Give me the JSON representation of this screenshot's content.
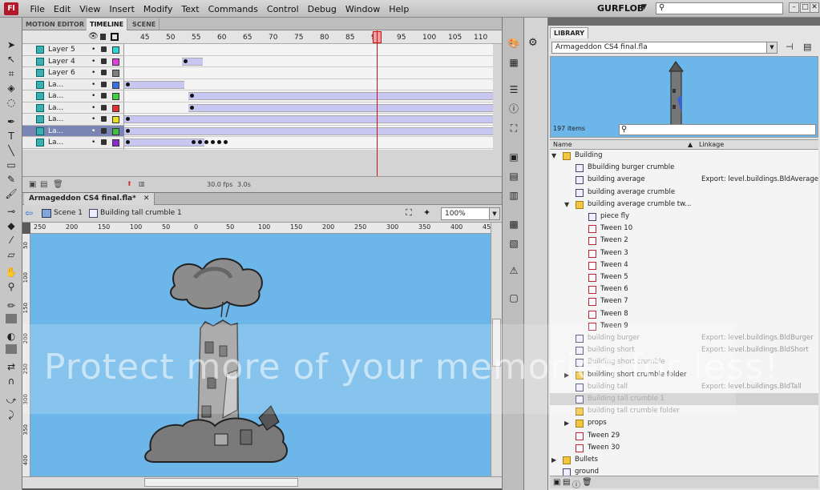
{
  "app": {
    "logo": "Fl",
    "workspace": "GURFLOB"
  },
  "menu": [
    "File",
    "Edit",
    "View",
    "Insert",
    "Modify",
    "Text",
    "Commands",
    "Control",
    "Debug",
    "Window",
    "Help"
  ],
  "timeline": {
    "tabs": [
      "MOTION EDITOR",
      "TIMELINE",
      "SCENE"
    ],
    "ticks": [
      "45",
      "50",
      "55",
      "60",
      "65",
      "70",
      "75",
      "80",
      "85",
      "90",
      "95",
      "100",
      "105",
      "110"
    ],
    "layers": [
      {
        "name": "Layer 5",
        "color": "#2fd8d8"
      },
      {
        "name": "Layer 4",
        "color": "#e040e0"
      },
      {
        "name": "Layer 6",
        "color": "#808080"
      },
      {
        "name": "La...",
        "color": "#3a6fe8"
      },
      {
        "name": "La...",
        "color": "#40d040"
      },
      {
        "name": "La...",
        "color": "#e03030"
      },
      {
        "name": "La...",
        "color": "#e8e020"
      },
      {
        "name": "La...",
        "color": "#40c040"
      },
      {
        "name": "La...",
        "color": "#8a2ad0"
      }
    ],
    "selected_layer": 7,
    "footer": {
      "fps": "30.0 fps",
      "time": "3.0s"
    }
  },
  "document": {
    "tab": "Armageddon CS4 final.fla*",
    "breadcrumb": [
      "Scene 1",
      "Building tall crumble 1"
    ],
    "zoom": "100%",
    "ruler_h": [
      "250",
      "200",
      "150",
      "100",
      "50",
      "0",
      "50",
      "100",
      "150",
      "200",
      "250",
      "300",
      "350",
      "400",
      "450"
    ],
    "ruler_v": [
      "50",
      "100",
      "150",
      "200",
      "250",
      "300",
      "350",
      "400"
    ]
  },
  "library": {
    "tab": "LIBRARY",
    "file": "Armageddon CS4 final.fla",
    "count": "197 items",
    "col_name": "Name",
    "col_link": "Linkage",
    "items": [
      {
        "name": "Building",
        "type": "folder",
        "indent": 1,
        "arrow": "▼",
        "link": ""
      },
      {
        "name": "Bbuilding burger crumble",
        "type": "sym",
        "indent": 2,
        "link": ""
      },
      {
        "name": "building average",
        "type": "sym",
        "indent": 2,
        "link": "Export: level.buildings.BldAverage"
      },
      {
        "name": "building average crumble",
        "type": "sym",
        "indent": 2,
        "link": ""
      },
      {
        "name": "building average crumble tw...",
        "type": "folder",
        "indent": 2,
        "arrow": "▼",
        "link": ""
      },
      {
        "name": "piece fly",
        "type": "sym",
        "indent": 3,
        "link": ""
      },
      {
        "name": "Tween 10",
        "type": "tween",
        "indent": 3,
        "link": ""
      },
      {
        "name": "Tween 2",
        "type": "tween",
        "indent": 3,
        "link": ""
      },
      {
        "name": "Tween 3",
        "type": "tween",
        "indent": 3,
        "link": ""
      },
      {
        "name": "Tween 4",
        "type": "tween",
        "indent": 3,
        "link": ""
      },
      {
        "name": "Tween 5",
        "type": "tween",
        "indent": 3,
        "link": ""
      },
      {
        "name": "Tween 6",
        "type": "tween",
        "indent": 3,
        "link": ""
      },
      {
        "name": "Tween 7",
        "type": "tween",
        "indent": 3,
        "link": ""
      },
      {
        "name": "Tween 8",
        "type": "tween",
        "indent": 3,
        "link": ""
      },
      {
        "name": "Tween 9",
        "type": "tween",
        "indent": 3,
        "link": ""
      },
      {
        "name": "building burger",
        "type": "sym",
        "indent": 2,
        "link": "Export: level.buildings.BldBurger",
        "dim": true
      },
      {
        "name": "building short",
        "type": "sym",
        "indent": 2,
        "link": "Export: level.buildings.BldShort",
        "dim": true
      },
      {
        "name": "Building short crumble",
        "type": "sym",
        "indent": 2,
        "link": "",
        "dim": true
      },
      {
        "name": "building short crumble folder",
        "type": "folder",
        "indent": 2,
        "arrow": "▶",
        "link": ""
      },
      {
        "name": "building tall",
        "type": "sym",
        "indent": 2,
        "link": "Export: level.buildings.BldTall",
        "dim": true
      },
      {
        "name": "Building tall crumble 1",
        "type": "sym",
        "indent": 2,
        "link": "",
        "dim": true,
        "hl": true
      },
      {
        "name": "building tall crumble folder",
        "type": "folder",
        "indent": 2,
        "link": "",
        "dim": true
      },
      {
        "name": "props",
        "type": "folder",
        "indent": 2,
        "arrow": "▶",
        "link": ""
      },
      {
        "name": "Tween 29",
        "type": "tween",
        "indent": 2,
        "link": ""
      },
      {
        "name": "Tween 30",
        "type": "tween",
        "indent": 2,
        "link": ""
      },
      {
        "name": "Bullets",
        "type": "folder",
        "indent": 1,
        "arrow": "▶",
        "link": ""
      },
      {
        "name": "ground",
        "type": "sym",
        "indent": 1,
        "link": ""
      }
    ]
  },
  "watermark": "Protect more of your memories for less!",
  "colors": {
    "stage": "#6cb6ea",
    "playhead": "#d01010",
    "tween": "#c7c7f2"
  }
}
